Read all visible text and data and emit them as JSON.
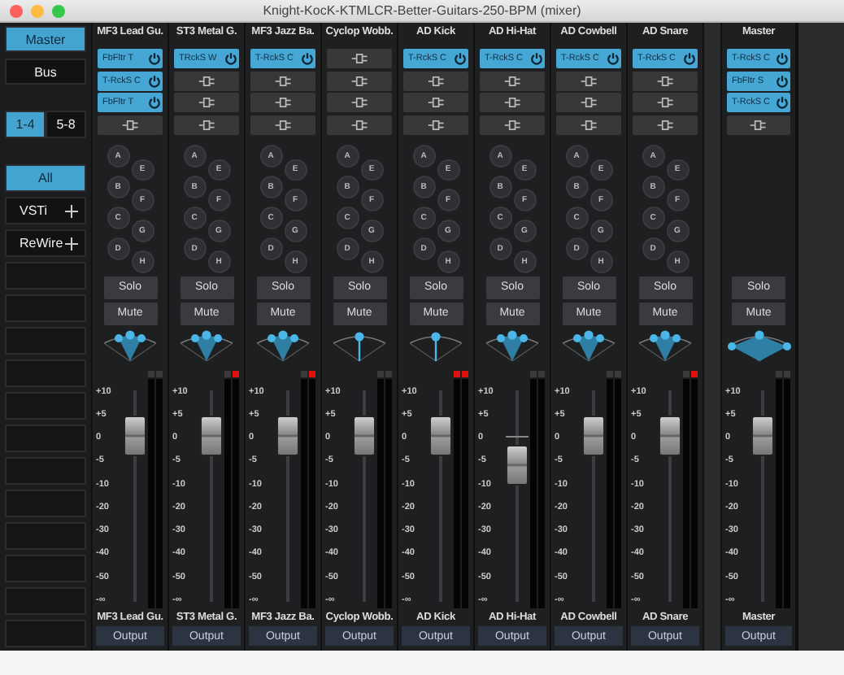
{
  "window": {
    "title": "Knight-KocK-KTMLCR-Better-Guitars-250-BPM (mixer)"
  },
  "sidebar": {
    "views": [
      {
        "label": "Master",
        "selected": true
      },
      {
        "label": "Bus",
        "selected": false
      }
    ],
    "banks": [
      {
        "label": "1-4",
        "selected": true
      },
      {
        "label": "5-8",
        "selected": false
      }
    ],
    "filters": [
      {
        "label": "All",
        "selected": true,
        "kind": "toggle"
      },
      {
        "label": "VSTi",
        "selected": false,
        "kind": "add"
      },
      {
        "label": "ReWire",
        "selected": false,
        "kind": "add"
      }
    ]
  },
  "channels": [
    {
      "name": "MF3 Lead Gu.",
      "inserts": [
        {
          "kind": "plugin",
          "label": "FbFltr T"
        },
        {
          "kind": "plugin",
          "label": "T-RckS C"
        },
        {
          "kind": "plugin",
          "label": "FbFltr T"
        },
        {
          "kind": "empty"
        }
      ],
      "sends": [
        "A",
        "B",
        "C",
        "D",
        "E",
        "F",
        "G",
        "H"
      ],
      "solo": "Solo",
      "mute": "Mute",
      "pan": {
        "kind": "stereo"
      },
      "meters": [
        {
          "clip": false
        },
        {
          "clip": false
        }
      ],
      "level": 0.78,
      "scale": [
        "+10",
        "+5",
        "0",
        "-5",
        "-10",
        "-20",
        "-30",
        "-40",
        "-50",
        "-∞"
      ],
      "footer": "MF3 Lead Gu.",
      "output": "Output"
    },
    {
      "name": "ST3 Metal G.",
      "inserts": [
        {
          "kind": "plugin",
          "label": "TRckS W"
        },
        {
          "kind": "empty"
        },
        {
          "kind": "empty"
        },
        {
          "kind": "empty"
        }
      ],
      "sends": [
        "A",
        "B",
        "C",
        "D",
        "E",
        "F",
        "G",
        "H"
      ],
      "solo": "Solo",
      "mute": "Mute",
      "pan": {
        "kind": "stereo"
      },
      "meters": [
        {
          "clip": false
        },
        {
          "clip": true
        }
      ],
      "level": 0.78,
      "scale": [
        "+10",
        "+5",
        "0",
        "-5",
        "-10",
        "-20",
        "-30",
        "-40",
        "-50",
        "-∞"
      ],
      "footer": "ST3 Metal G.",
      "output": "Output"
    },
    {
      "name": "MF3 Jazz Ba.",
      "inserts": [
        {
          "kind": "plugin",
          "label": "T-RckS C"
        },
        {
          "kind": "empty"
        },
        {
          "kind": "empty"
        },
        {
          "kind": "empty"
        }
      ],
      "sends": [
        "A",
        "B",
        "C",
        "D",
        "E",
        "F",
        "G",
        "H"
      ],
      "solo": "Solo",
      "mute": "Mute",
      "pan": {
        "kind": "stereo"
      },
      "meters": [
        {
          "clip": false
        },
        {
          "clip": true
        }
      ],
      "level": 0.78,
      "scale": [
        "+10",
        "+5",
        "0",
        "-5",
        "-10",
        "-20",
        "-30",
        "-40",
        "-50",
        "-∞"
      ],
      "footer": "MF3 Jazz Ba.",
      "output": "Output"
    },
    {
      "name": "Cyclop Wobb.",
      "inserts": [
        {
          "kind": "empty"
        },
        {
          "kind": "empty"
        },
        {
          "kind": "empty"
        },
        {
          "kind": "empty"
        }
      ],
      "sends": [
        "A",
        "B",
        "C",
        "D",
        "E",
        "F",
        "G",
        "H"
      ],
      "solo": "Solo",
      "mute": "Mute",
      "pan": {
        "kind": "mono"
      },
      "meters": [
        {
          "clip": false
        },
        {
          "clip": false
        }
      ],
      "level": 0.78,
      "scale": [
        "+10",
        "+5",
        "0",
        "-5",
        "-10",
        "-20",
        "-30",
        "-40",
        "-50",
        "-∞"
      ],
      "footer": "Cyclop Wobb.",
      "output": "Output"
    },
    {
      "name": "AD Kick",
      "inserts": [
        {
          "kind": "plugin",
          "label": "T-RckS C"
        },
        {
          "kind": "empty"
        },
        {
          "kind": "empty"
        },
        {
          "kind": "empty"
        }
      ],
      "sends": [
        "A",
        "B",
        "C",
        "D",
        "E",
        "F",
        "G",
        "H"
      ],
      "solo": "Solo",
      "mute": "Mute",
      "pan": {
        "kind": "mono"
      },
      "meters": [
        {
          "clip": true
        },
        {
          "clip": true
        }
      ],
      "level": 0.78,
      "scale": [
        "+10",
        "+5",
        "0",
        "-5",
        "-10",
        "-20",
        "-30",
        "-40",
        "-50",
        "-∞"
      ],
      "footer": "AD Kick",
      "output": "Output"
    },
    {
      "name": "AD Hi-Hat",
      "inserts": [
        {
          "kind": "plugin",
          "label": "T-RckS C"
        },
        {
          "kind": "empty"
        },
        {
          "kind": "empty"
        },
        {
          "kind": "empty"
        }
      ],
      "sends": [
        "A",
        "B",
        "C",
        "D",
        "E",
        "F",
        "G",
        "H"
      ],
      "solo": "Solo",
      "mute": "Mute",
      "pan": {
        "kind": "stereo"
      },
      "meters": [
        {
          "clip": false
        },
        {
          "clip": false
        }
      ],
      "level": 0.64,
      "scale": [
        "+10",
        "+5",
        "0",
        "-5",
        "-10",
        "-20",
        "-30",
        "-40",
        "-50",
        "-∞"
      ],
      "footer": "AD Hi-Hat",
      "output": "Output"
    },
    {
      "name": "AD Cowbell",
      "inserts": [
        {
          "kind": "plugin",
          "label": "T-RckS C"
        },
        {
          "kind": "empty"
        },
        {
          "kind": "empty"
        },
        {
          "kind": "empty"
        }
      ],
      "sends": [
        "A",
        "B",
        "C",
        "D",
        "E",
        "F",
        "G",
        "H"
      ],
      "solo": "Solo",
      "mute": "Mute",
      "pan": {
        "kind": "stereo"
      },
      "meters": [
        {
          "clip": false
        },
        {
          "clip": false
        }
      ],
      "level": 0.78,
      "scale": [
        "+10",
        "+5",
        "0",
        "-5",
        "-10",
        "-20",
        "-30",
        "-40",
        "-50",
        "-∞"
      ],
      "footer": "AD Cowbell",
      "output": "Output"
    },
    {
      "name": "AD Snare",
      "inserts": [
        {
          "kind": "plugin",
          "label": "T-RckS C"
        },
        {
          "kind": "empty"
        },
        {
          "kind": "empty"
        },
        {
          "kind": "empty"
        }
      ],
      "sends": [
        "A",
        "B",
        "C",
        "D",
        "E",
        "F",
        "G",
        "H"
      ],
      "solo": "Solo",
      "mute": "Mute",
      "pan": {
        "kind": "stereo"
      },
      "meters": [
        {
          "clip": false
        },
        {
          "clip": true
        }
      ],
      "level": 0.78,
      "scale": [
        "+10",
        "+5",
        "0",
        "-5",
        "-10",
        "-20",
        "-30",
        "-40",
        "-50",
        "-∞"
      ],
      "footer": "AD Snare",
      "output": "Output"
    }
  ],
  "master": {
    "name": "Master",
    "inserts": [
      {
        "kind": "plugin",
        "label": "T-RckS C"
      },
      {
        "kind": "plugin",
        "label": "FbFltr S"
      },
      {
        "kind": "plugin",
        "label": "T-RckS C"
      },
      {
        "kind": "empty"
      }
    ],
    "solo": "Solo",
    "mute": "Mute",
    "pan": {
      "kind": "wide"
    },
    "meters": [
      {
        "clip": false
      },
      {
        "clip": false
      }
    ],
    "level": 0.78,
    "scale": [
      "+10",
      "+5",
      "0",
      "-5",
      "-10",
      "-20",
      "-30",
      "-40",
      "-50",
      "-∞"
    ],
    "footer": "Master",
    "output": "Output"
  }
}
